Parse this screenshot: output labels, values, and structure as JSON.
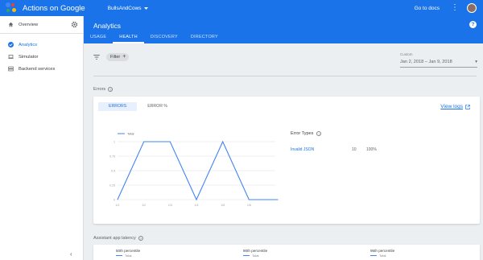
{
  "topbar": {
    "title": "Actions on Google",
    "project": "BullsAndCows",
    "docs_label": "Go to docs",
    "icons": [
      "google-assistant-logo",
      "chevron-down-icon",
      "more-vert-icon",
      "avatar"
    ]
  },
  "sidebar": {
    "overview": "Overview",
    "items": [
      {
        "label": "Analytics",
        "icon": "analytics-check-icon",
        "active": true
      },
      {
        "label": "Simulator",
        "icon": "laptop-icon",
        "active": false
      },
      {
        "label": "Backend services",
        "icon": "server-icon",
        "active": false
      }
    ],
    "collapse_glyph": "‹"
  },
  "header": {
    "title": "Analytics",
    "help_glyph": "?",
    "tabs": [
      {
        "label": "USAGE",
        "active": false
      },
      {
        "label": "HEALTH",
        "active": true
      },
      {
        "label": "DISCOVERY",
        "active": false
      },
      {
        "label": "DIRECTORY",
        "active": false
      }
    ]
  },
  "filter": {
    "label": "Filter",
    "plus": "+",
    "custom_label": "Custom",
    "date_range": "Jan 2, 2018 – Jan 9, 2018",
    "dropdown_glyph": "▾"
  },
  "errors": {
    "section_label": "Errors",
    "tabs": [
      {
        "label": "ERRORS",
        "active": true
      },
      {
        "label": "ERROR %",
        "active": false
      }
    ],
    "view_logs": "View logs",
    "error_types_label": "Error Types",
    "error_types": [
      {
        "type": "Invalid JSON",
        "count": "10",
        "percent": "100%"
      }
    ]
  },
  "chart_data": {
    "type": "line",
    "x": [
      "1/1",
      "1/2",
      "1/3",
      "1/4",
      "1/5",
      "1/6"
    ],
    "y_ticks": [
      "0",
      "0.25",
      "0.5",
      "0.75",
      "1"
    ],
    "ylim": [
      0,
      1
    ],
    "grid": true,
    "legend_position": "top-left",
    "series": [
      {
        "name": "Total",
        "color": "#4285f4",
        "points": [
          [
            0,
            0
          ],
          [
            1,
            1
          ],
          [
            2,
            1
          ],
          [
            3,
            0
          ],
          [
            4,
            1
          ],
          [
            5,
            0
          ],
          [
            6.1,
            0
          ]
        ]
      }
    ]
  },
  "latency": {
    "section_label": "Assistant app latency",
    "percentiles": [
      {
        "title": "50th percentile",
        "legend": "Total"
      },
      {
        "title": "90th percentile",
        "legend": "Total"
      },
      {
        "title": "95th percentile",
        "legend": "Total"
      }
    ]
  }
}
